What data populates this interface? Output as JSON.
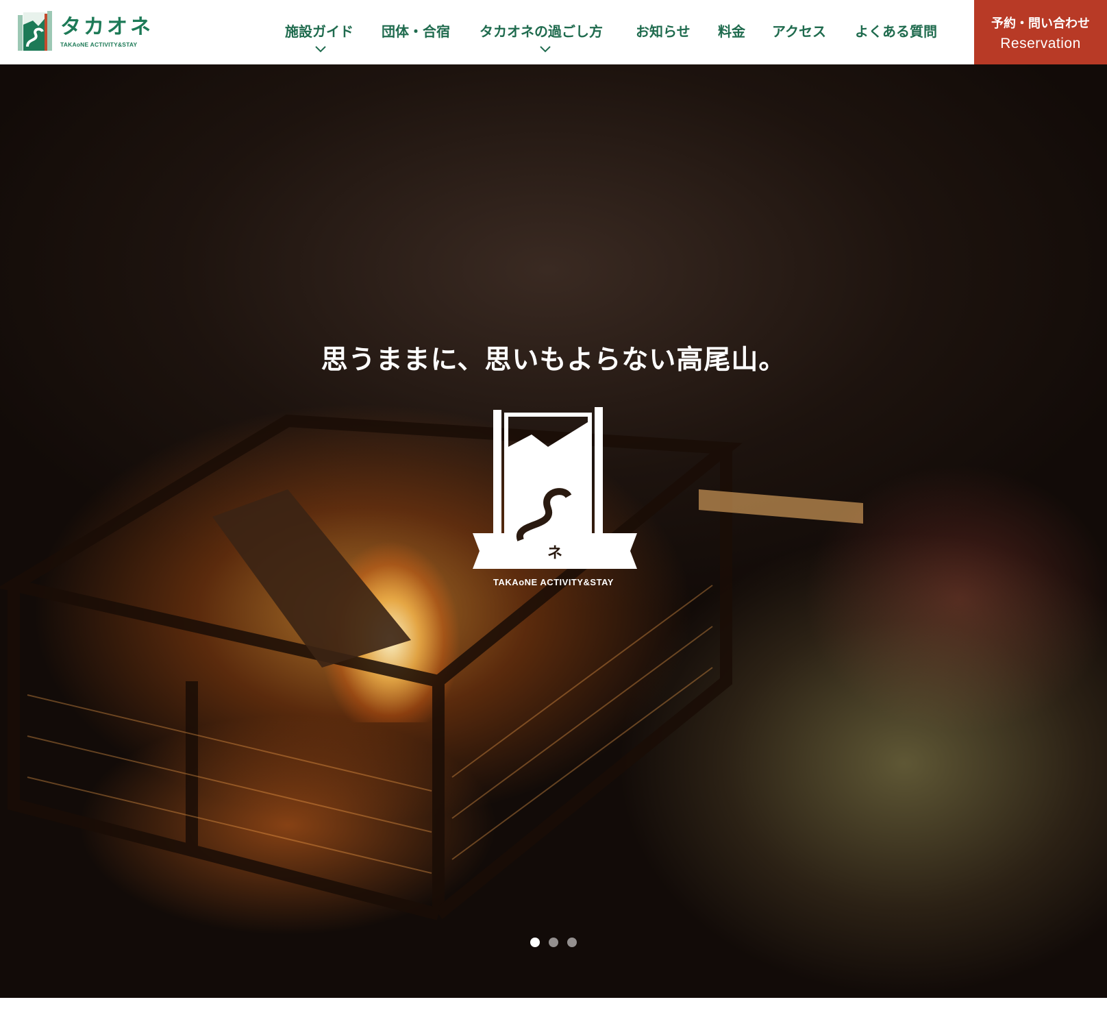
{
  "brand": {
    "name": "タカオネ",
    "tagline_en": "TAKAoNE ACTIVITY&STAY"
  },
  "nav": {
    "items": [
      {
        "label": "施設ガイド",
        "has_dropdown": true
      },
      {
        "label": "団体・合宿",
        "has_dropdown": false
      },
      {
        "label": "タカオネの過ごし方",
        "has_dropdown": true
      },
      {
        "label": "お知らせ",
        "has_dropdown": false
      },
      {
        "label": "料金",
        "has_dropdown": false
      },
      {
        "label": "アクセス",
        "has_dropdown": false
      },
      {
        "label": "よくある質問",
        "has_dropdown": false
      }
    ],
    "reserve": {
      "label_ja": "予約・問い合わせ",
      "label_en": "Reservation"
    }
  },
  "hero": {
    "headline": "思うままに、思いもよらない高尾山。",
    "logo_sub": "TAKAoNE ACTIVITY&STAY",
    "slides": {
      "count": 3,
      "active": 1
    }
  },
  "colors": {
    "brand_green": "#1d7a57",
    "nav_text": "#1f6b4e",
    "reserve_bg": "#b83a26"
  }
}
